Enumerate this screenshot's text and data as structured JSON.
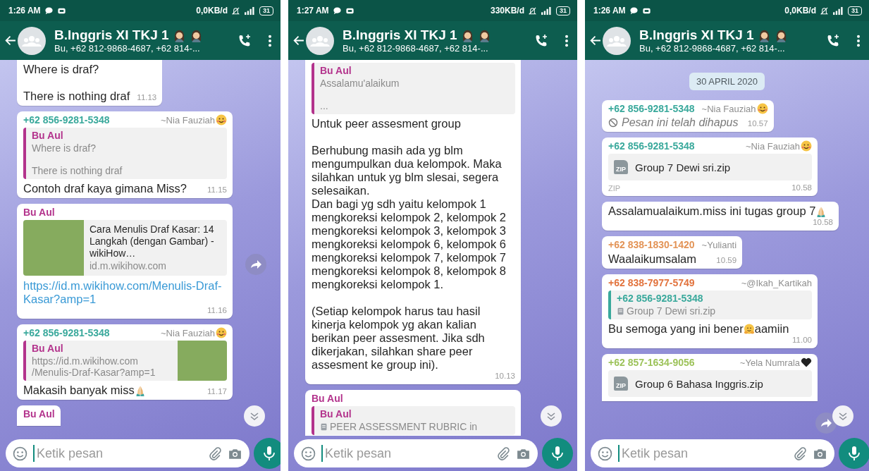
{
  "phones": [
    {
      "status": {
        "time": "1:26 AM",
        "data_rate": "0,0KB/d",
        "battery": "31"
      },
      "header": {
        "title": "B.Inggris XI TKJ 1",
        "title_emoji": [
          {
            "kind": "person"
          },
          {
            "kind": "person"
          }
        ],
        "subtitle": "Bu, +62 812-9868-4687, +62 814-..."
      },
      "messages": [
        {
          "kind": "text",
          "cut_top": true,
          "text": "Where is draf?\n\nThere is nothing draf",
          "time": "11.13"
        },
        {
          "kind": "text",
          "sender": {
            "label": "+62 856-9281-5348",
            "color": "#3aa99c",
            "name": "~Nia Fauziah",
            "emoji": {
              "kind": "face"
            }
          },
          "quote": {
            "author": "Bu Aul",
            "color": "#b3338c",
            "text": "Where is draf?\n\nThere is nothing draf"
          },
          "text": "Contoh draf kaya gimana Miss?",
          "time": "11.15"
        },
        {
          "kind": "link",
          "sender": {
            "label": "Bu Aul",
            "color": "#b3338c"
          },
          "preview": {
            "title": "Cara Menulis Draf Kasar: 14 Langkah (dengan Gambar) - wikiHow…",
            "domain": "id.m.wikihow.com"
          },
          "text": "https://id.m.wikihow.com/Menulis-Draf-Kasar?amp=1",
          "time": "11.16"
        },
        {
          "kind": "text",
          "sender": {
            "label": "+62 856-9281-5348",
            "color": "#3aa99c",
            "name": "~Nia Fauziah",
            "emoji": {
              "kind": "face"
            }
          },
          "quote": {
            "author": "Bu Aul",
            "color": "#b3338c",
            "text": "https://id.m.wikihow.com\n/Menulis-Draf-Kasar?amp=1",
            "thumbnail": true
          },
          "text": "Makasih banyak miss",
          "emoji": {
            "kind": "pray"
          },
          "time": "11.17"
        },
        {
          "kind": "text",
          "cut_bottom": true,
          "sender": {
            "label": "Bu Aul",
            "color": "#b3338c"
          }
        }
      ],
      "forward_button": {
        "kind": "middle"
      },
      "scroll_down_button": true,
      "composer": {
        "placeholder": "Ketik pesan"
      }
    },
    {
      "status": {
        "time": "1:27 AM",
        "data_rate": "330KB/d",
        "battery": "31"
      },
      "header": {
        "title": "B.Inggris XI TKJ 1",
        "title_emoji": [
          {
            "kind": "person"
          },
          {
            "kind": "person"
          }
        ],
        "subtitle": "Bu, +62 812-9868-4687, +62 814-..."
      },
      "messages": [
        {
          "kind": "text",
          "cut_top": true,
          "quote": {
            "author": "Bu Aul",
            "color": "#b3338c",
            "text": "Assalamu'alaikum\n\n..."
          },
          "text": "Untuk peer assesment group\n\nBerhubung masih ada yg blm mengumpulkan dua kelompok. Maka silahkan untuk yg blm slesai, segera selesaikan.\nDan bagi yg sdh yaitu kelompok 1 mengkoreksi kelompok 2, kelompok 2 mengkoreksi kelompok 3, kelompok 3 mengkoreksi kelompok 6, kelompok 6 mengkoreksi kelompok 7, kelompok 7 mengkoreksi kelompok 8, kelompok 8 mengkoreksi kelompok 1.\n\n(Setiap kelompok harus tau hasil kinerja kelompok yg akan kalian berikan peer assesment. Jika sdh dikerjakan, silahkan share peer assesment ke group ini).",
          "time": "10.13"
        },
        {
          "kind": "text",
          "cut_bottom": true,
          "sender": {
            "label": "Bu Aul",
            "color": "#b3338c"
          },
          "quote": {
            "author": "Bu Aul",
            "color": "#b3338c",
            "text": "PEER ASSESSMENT RUBRIC in",
            "doc_icon": true
          }
        }
      ],
      "scroll_down_button": true,
      "composer": {
        "placeholder": "Ketik pesan"
      }
    },
    {
      "status": {
        "time": "1:26 AM",
        "data_rate": "0,0KB/d",
        "battery": "31"
      },
      "header": {
        "title": "B.Inggris XI TKJ 1",
        "title_emoji": [
          {
            "kind": "person"
          },
          {
            "kind": "person"
          }
        ],
        "subtitle": "Bu, +62 812-9868-4687, +62 814-..."
      },
      "messages": [
        {
          "kind": "date",
          "text": "30 APRIL 2020"
        },
        {
          "kind": "deleted",
          "sender": {
            "label": "+62 856-9281-5348",
            "color": "#3aa99c",
            "name": "~Nia Fauziah",
            "emoji": {
              "kind": "face"
            }
          },
          "text": "Pesan ini telah dihapus",
          "time": "10.57"
        },
        {
          "kind": "file",
          "sender": {
            "label": "+62 856-9281-5348",
            "color": "#3aa99c",
            "name": "~Nia Fauziah",
            "emoji": {
              "kind": "face"
            }
          },
          "file": {
            "name": "Group 7 Dewi sri.zip",
            "icon_label": "ZIP",
            "type": "ZIP"
          },
          "time": "10.58"
        },
        {
          "kind": "text",
          "text": "Assalamualaikum.miss ini tugas group 7",
          "emoji": {
            "kind": "pray"
          },
          "time": "10.58"
        },
        {
          "kind": "text",
          "sender": {
            "label": "+62 838-1830-1420",
            "color": "#e39457",
            "name": "~Yulianti"
          },
          "text": "Waalaikumsalam",
          "time": "10.59"
        },
        {
          "kind": "text",
          "sender": {
            "label": "+62 838-7977-5749",
            "color": "#e2733d",
            "name": "~@Ikah_Kartikah"
          },
          "quote": {
            "author": "+62 856-9281-5348",
            "color": "#3aa99c",
            "text": "Group 7 Dewi sri.zip",
            "doc_icon": true
          },
          "text": "Bu semoga yang ini bener",
          "emoji": {
            "kind": "hug"
          },
          "text_after": "aamiin",
          "time": "11.00"
        },
        {
          "kind": "file",
          "cut_bottom": true,
          "sender": {
            "label": "+62 857-1634-9056",
            "color": "#9dc35a",
            "name": "~Yela Numrala",
            "emoji": {
              "kind": "heart"
            }
          },
          "file": {
            "name": "Group 6 Bahasa Inggris.zip",
            "icon_label": "ZIP"
          }
        }
      ],
      "forward_button": {
        "kind": "bottom"
      },
      "scroll_down_button": true,
      "composer": {
        "placeholder": "Ketik pesan"
      }
    }
  ]
}
